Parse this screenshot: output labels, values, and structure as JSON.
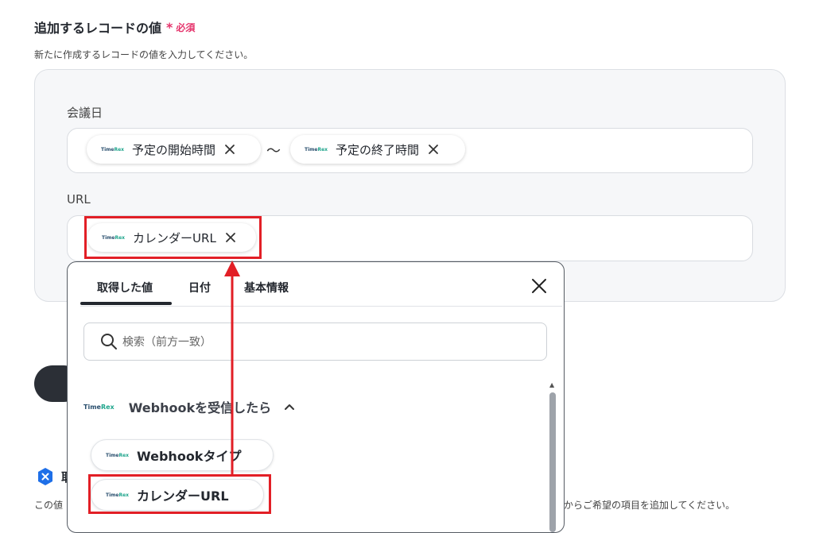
{
  "section": {
    "title": "追加するレコードの値",
    "required_mark": "*",
    "required_text": "必須",
    "description": "新たに作成するレコードの値を入力してください。"
  },
  "fields": {
    "meeting_date": {
      "label": "会議日",
      "chips": [
        "予定の開始時間",
        "予定の終了時間"
      ],
      "separator": "〜"
    },
    "url": {
      "label": "URL",
      "chips": [
        "カレンダーURL"
      ]
    }
  },
  "logo": {
    "part1": "Time",
    "part2": "Rex"
  },
  "popup": {
    "tabs": [
      "取得した値",
      "日付",
      "基本情報"
    ],
    "active_tab": "取得した値",
    "search_placeholder": "検索（前方一致）",
    "group_label": "Webhookを受信したら",
    "items": [
      "Webhookタイプ",
      "カレンダーURL"
    ]
  },
  "notice": {
    "title_fragment": "取",
    "text_left": "この値",
    "text_right": "からご希望の項目を追加してください。"
  },
  "colors": {
    "required": "#e5336b",
    "highlight": "#e21f26",
    "logo_accent": "#1fa58c",
    "notice_icon": "#1e6fe8"
  },
  "icons": [
    "close-icon",
    "search-icon",
    "chevron-up-icon",
    "x-badge-icon"
  ]
}
